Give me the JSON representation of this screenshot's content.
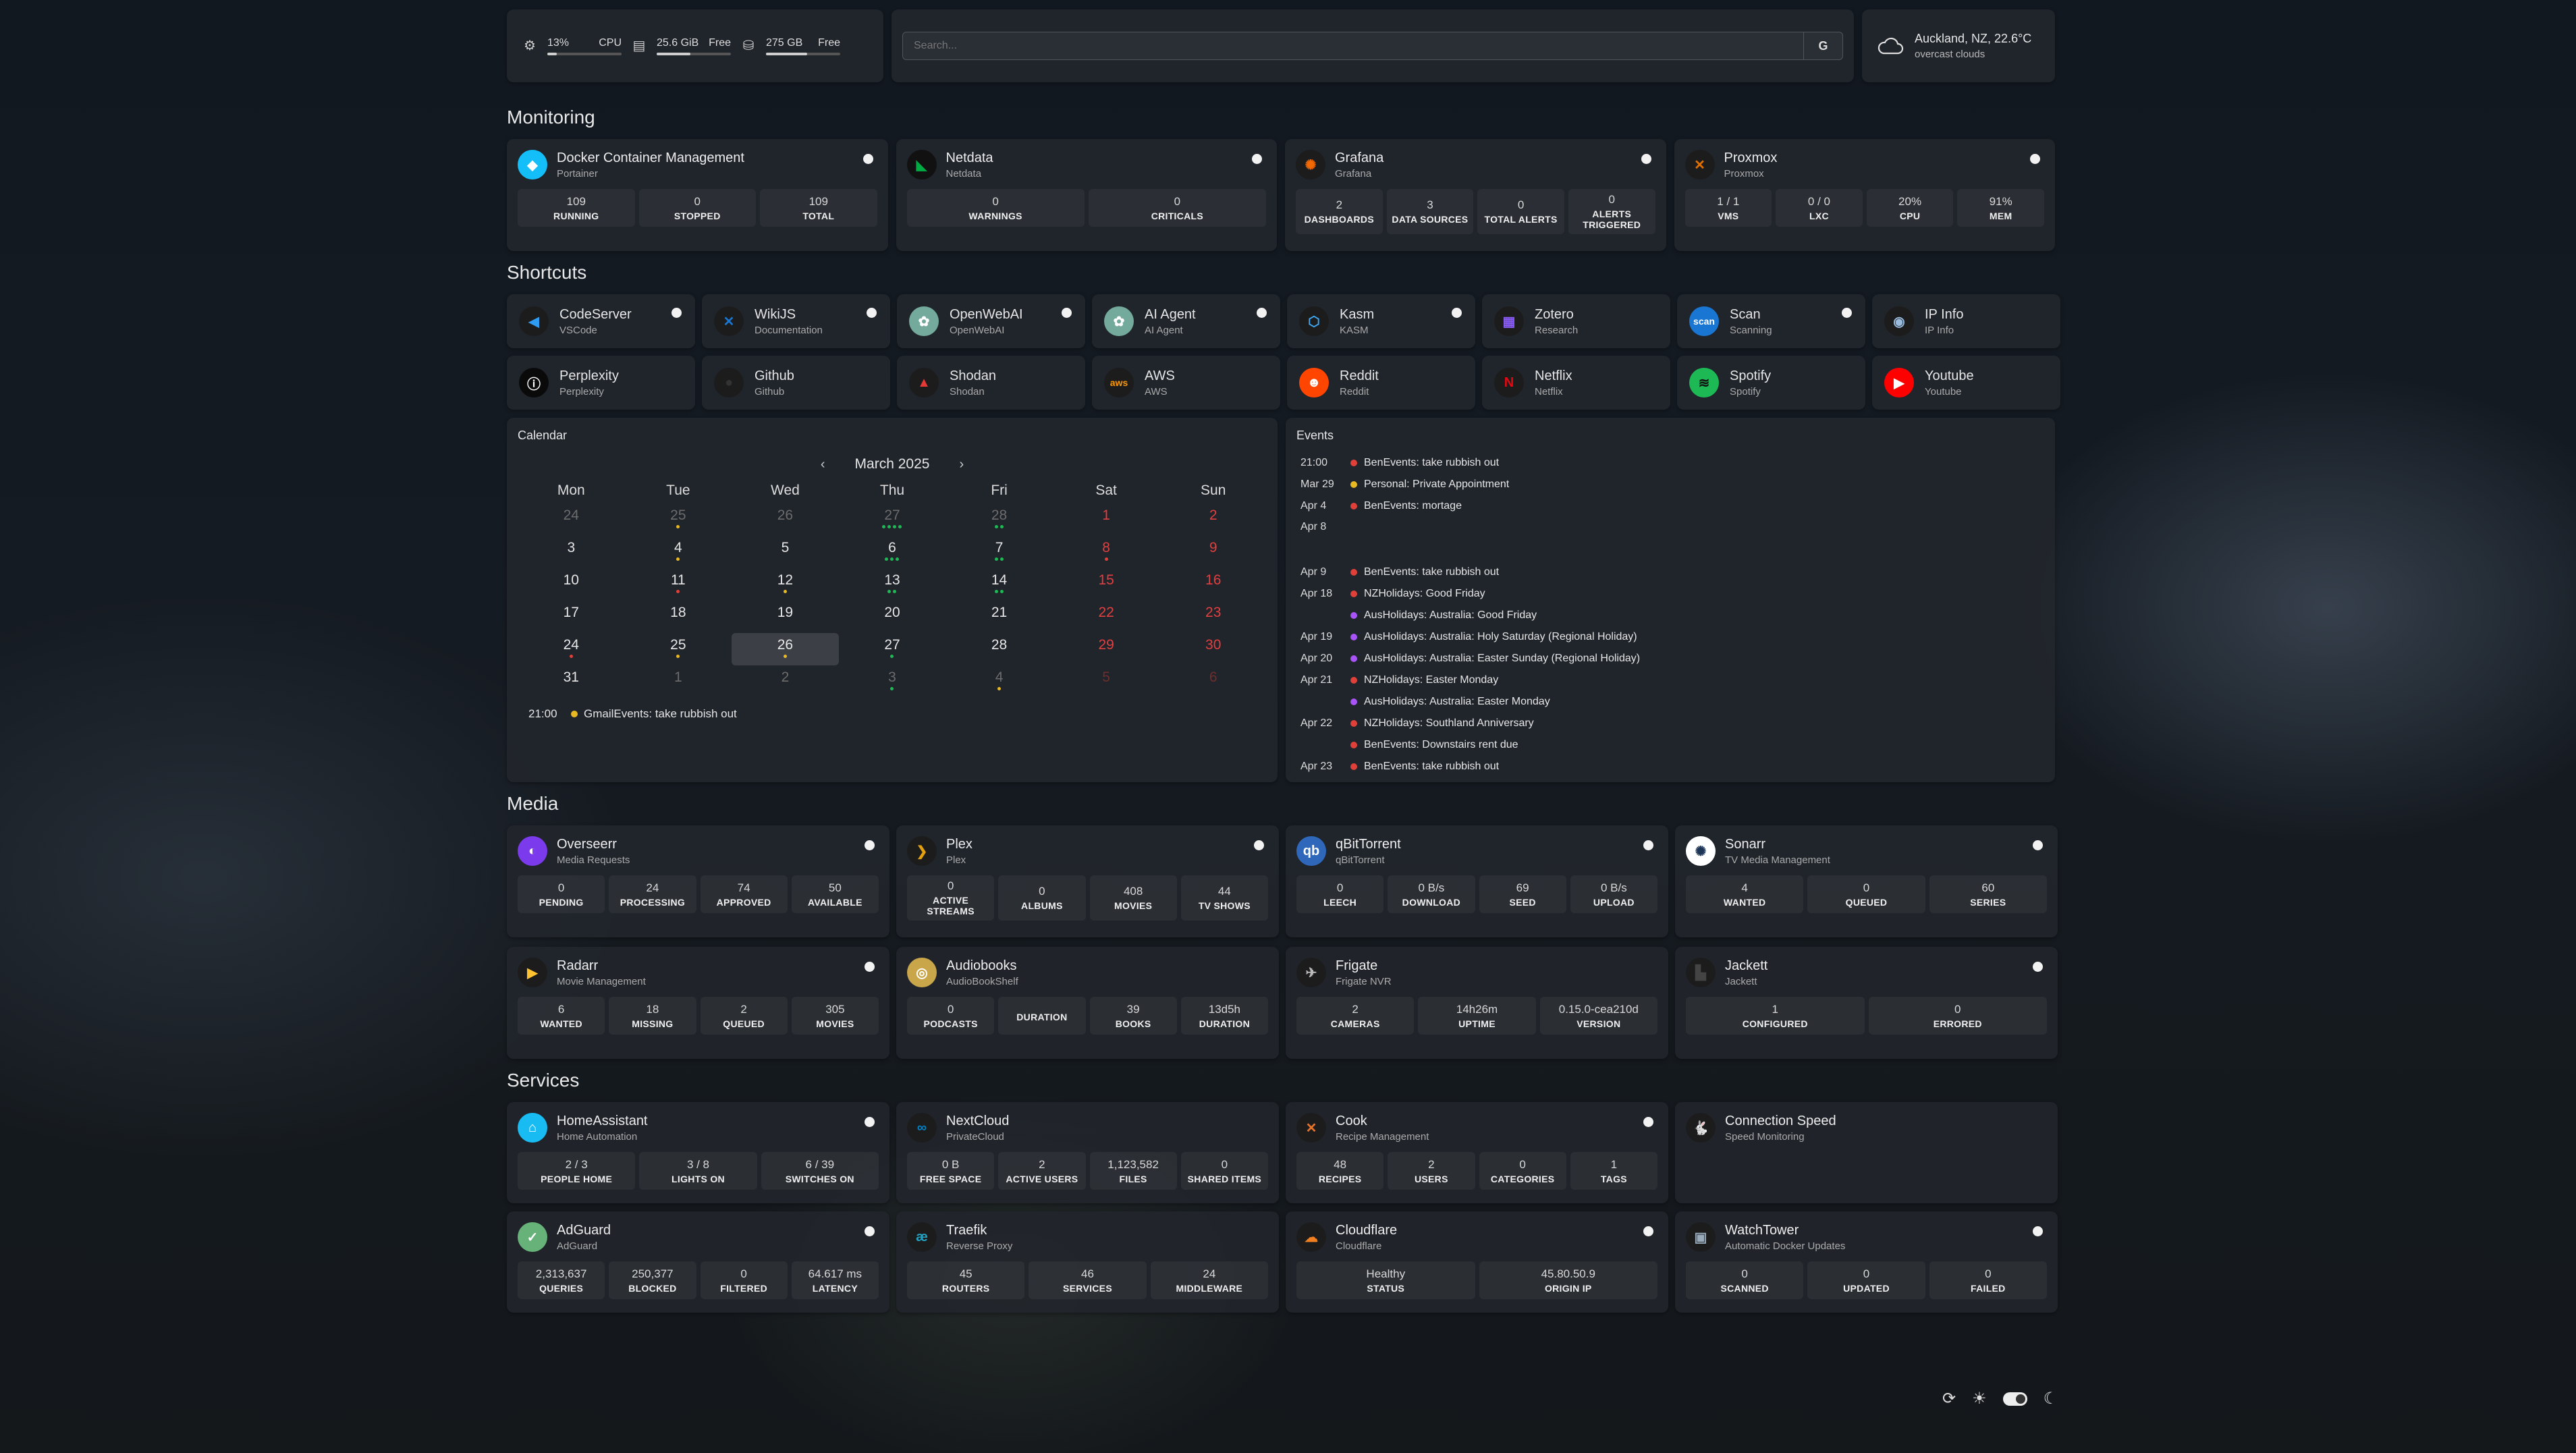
{
  "resources": {
    "cpu_value": "13%",
    "cpu_label": "CPU",
    "cpu_fraction": 0.13,
    "mem_value": "25.6 GiB",
    "mem_label": "Free",
    "mem_fraction": 0.45,
    "disk_value": "275 GB",
    "disk_label": "Free",
    "disk_fraction": 0.55
  },
  "search": {
    "placeholder": "Search...",
    "button": "G"
  },
  "weather": {
    "location": "Auckland, NZ, 22.6°C",
    "condition": "overcast clouds"
  },
  "sections": {
    "monitoring": "Monitoring",
    "shortcuts": "Shortcuts",
    "media": "Media",
    "services": "Services"
  },
  "monitoring": [
    {
      "name": "Docker Container Management",
      "sub": "Portainer",
      "stats": [
        [
          "109",
          "RUNNING"
        ],
        [
          "0",
          "STOPPED"
        ],
        [
          "109",
          "TOTAL"
        ]
      ]
    },
    {
      "name": "Netdata",
      "sub": "Netdata",
      "stats": [
        [
          "0",
          "WARNINGS"
        ],
        [
          "0",
          "CRITICALS"
        ]
      ]
    },
    {
      "name": "Grafana",
      "sub": "Grafana",
      "stats": [
        [
          "2",
          "DASHBOARDS"
        ],
        [
          "3",
          "DATA SOURCES"
        ],
        [
          "0",
          "TOTAL ALERTS"
        ],
        [
          "0",
          "ALERTS TRIGGERED"
        ]
      ]
    },
    {
      "name": "Proxmox",
      "sub": "Proxmox",
      "stats": [
        [
          "1 / 1",
          "VMS"
        ],
        [
          "0 / 0",
          "LXC"
        ],
        [
          "20%",
          "CPU"
        ],
        [
          "91%",
          "MEM"
        ]
      ]
    }
  ],
  "shortcuts": [
    {
      "name": "CodeServer",
      "sub": "VSCode"
    },
    {
      "name": "WikiJS",
      "sub": "Documentation"
    },
    {
      "name": "OpenWebAI",
      "sub": "OpenWebAI"
    },
    {
      "name": "AI Agent",
      "sub": "AI Agent"
    },
    {
      "name": "Kasm",
      "sub": "KASM"
    },
    {
      "name": "Zotero",
      "sub": "Research"
    },
    {
      "name": "Scan",
      "sub": "Scanning"
    },
    {
      "name": "IP Info",
      "sub": "IP Info"
    },
    {
      "name": "Perplexity",
      "sub": "Perplexity"
    },
    {
      "name": "Github",
      "sub": "Github"
    },
    {
      "name": "Shodan",
      "sub": "Shodan"
    },
    {
      "name": "AWS",
      "sub": "AWS"
    },
    {
      "name": "Reddit",
      "sub": "Reddit"
    },
    {
      "name": "Netflix",
      "sub": "Netflix"
    },
    {
      "name": "Spotify",
      "sub": "Spotify"
    },
    {
      "name": "Youtube",
      "sub": "Youtube"
    }
  ],
  "calendar": {
    "title": "Calendar",
    "month": "March 2025",
    "prev": "‹",
    "next": "›",
    "weekdays": [
      "Mon",
      "Tue",
      "Wed",
      "Thu",
      "Fri",
      "Sat",
      "Sun"
    ],
    "days": [
      [
        "24",
        "25",
        "26",
        "27",
        "28",
        "1",
        "2"
      ],
      [
        "3",
        "4",
        "5",
        "6",
        "7",
        "8",
        "9"
      ],
      [
        "10",
        "11",
        "12",
        "13",
        "14",
        "15",
        "16"
      ],
      [
        "17",
        "18",
        "19",
        "20",
        "21",
        "22",
        "23"
      ],
      [
        "24",
        "25",
        "26",
        "27",
        "28",
        "29",
        "30"
      ],
      [
        "31",
        "1",
        "2",
        "3",
        "4",
        "5",
        "6"
      ]
    ],
    "event_time": "21:00",
    "event_text": "GmailEvents: take rubbish out"
  },
  "events": {
    "title": "Events",
    "items": [
      {
        "date": "21:00",
        "color": "#e0403a",
        "text": "BenEvents: take rubbish out"
      },
      {
        "date": "Mar 29",
        "color": "#e8b923",
        "text": "Personal: Private Appointment"
      },
      {
        "date": "Apr 4",
        "color": "#e0403a",
        "text": "BenEvents: mortage"
      },
      {
        "date": "Apr 8",
        "color": "",
        "text": ""
      },
      {
        "date": "Apr 9",
        "color": "#e0403a",
        "text": "BenEvents: take rubbish out"
      },
      {
        "date": "Apr 18",
        "color": "#e0403a",
        "text": "NZHolidays: Good Friday"
      },
      {
        "date": "",
        "color": "#a855f7",
        "text": "AusHolidays: Australia: Good Friday"
      },
      {
        "date": "Apr 19",
        "color": "#a855f7",
        "text": "AusHolidays: Australia: Holy Saturday (Regional Holiday)"
      },
      {
        "date": "Apr 20",
        "color": "#a855f7",
        "text": "AusHolidays: Australia: Easter Sunday (Regional Holiday)"
      },
      {
        "date": "Apr 21",
        "color": "#e0403a",
        "text": "NZHolidays: Easter Monday"
      },
      {
        "date": "",
        "color": "#a855f7",
        "text": "AusHolidays: Australia: Easter Monday"
      },
      {
        "date": "Apr 22",
        "color": "#e0403a",
        "text": "NZHolidays: Southland Anniversary"
      },
      {
        "date": "",
        "color": "#e0403a",
        "text": "BenEvents: Downstairs rent due"
      },
      {
        "date": "Apr 23",
        "color": "#e0403a",
        "text": "BenEvents: take rubbish out"
      }
    ]
  },
  "media": [
    {
      "name": "Overseerr",
      "sub": "Media Requests",
      "stats": [
        [
          "0",
          "PENDING"
        ],
        [
          "24",
          "PROCESSING"
        ],
        [
          "74",
          "APPROVED"
        ],
        [
          "50",
          "AVAILABLE"
        ]
      ]
    },
    {
      "name": "Plex",
      "sub": "Plex",
      "stats": [
        [
          "0",
          "ACTIVE STREAMS"
        ],
        [
          "0",
          "ALBUMS"
        ],
        [
          "408",
          "MOVIES"
        ],
        [
          "44",
          "TV SHOWS"
        ]
      ]
    },
    {
      "name": "qBitTorrent",
      "sub": "qBitTorrent",
      "stats": [
        [
          "0",
          "LEECH"
        ],
        [
          "0 B/s",
          "DOWNLOAD"
        ],
        [
          "69",
          "SEED"
        ],
        [
          "0 B/s",
          "UPLOAD"
        ]
      ]
    },
    {
      "name": "Sonarr",
      "sub": "TV Media Management",
      "stats": [
        [
          "4",
          "WANTED"
        ],
        [
          "0",
          "QUEUED"
        ],
        [
          "60",
          "SERIES"
        ]
      ]
    },
    {
      "name": "Radarr",
      "sub": "Movie Management",
      "stats": [
        [
          "6",
          "WANTED"
        ],
        [
          "18",
          "MISSING"
        ],
        [
          "2",
          "QUEUED"
        ],
        [
          "305",
          "MOVIES"
        ]
      ]
    },
    {
      "name": "Audiobooks",
      "sub": "AudioBookShelf",
      "stats": [
        [
          "0",
          "PODCASTS"
        ],
        [
          "",
          "DURATION"
        ],
        [
          "39",
          "BOOKS"
        ],
        [
          "13d5h",
          "DURATION"
        ]
      ]
    },
    {
      "name": "Frigate",
      "sub": "Frigate NVR",
      "stats": [
        [
          "2",
          "CAMERAS"
        ],
        [
          "14h26m",
          "UPTIME"
        ],
        [
          "0.15.0-cea210d",
          "VERSION"
        ]
      ]
    },
    {
      "name": "Jackett",
      "sub": "Jackett",
      "stats": [
        [
          "1",
          "CONFIGURED"
        ],
        [
          "0",
          "ERRORED"
        ]
      ]
    }
  ],
  "services": [
    {
      "name": "HomeAssistant",
      "sub": "Home Automation",
      "stats": [
        [
          "2 / 3",
          "PEOPLE HOME"
        ],
        [
          "3 / 8",
          "LIGHTS ON"
        ],
        [
          "6 / 39",
          "SWITCHES ON"
        ]
      ]
    },
    {
      "name": "NextCloud",
      "sub": "PrivateCloud",
      "stats": [
        [
          "0 B",
          "FREE SPACE"
        ],
        [
          "2",
          "ACTIVE USERS"
        ],
        [
          "1,123,582",
          "FILES"
        ],
        [
          "0",
          "SHARED ITEMS"
        ]
      ]
    },
    {
      "name": "Cook",
      "sub": "Recipe Management",
      "stats": [
        [
          "48",
          "RECIPES"
        ],
        [
          "2",
          "USERS"
        ],
        [
          "0",
          "CATEGORIES"
        ],
        [
          "1",
          "TAGS"
        ]
      ]
    },
    {
      "name": "Connection Speed",
      "sub": "Speed Monitoring",
      "stats": []
    },
    {
      "name": "AdGuard",
      "sub": "AdGuard",
      "stats": [
        [
          "2,313,637",
          "QUERIES"
        ],
        [
          "250,377",
          "BLOCKED"
        ],
        [
          "0",
          "FILTERED"
        ],
        [
          "64.617 ms",
          "LATENCY"
        ]
      ]
    },
    {
      "name": "Traefik",
      "sub": "Reverse Proxy",
      "stats": [
        [
          "45",
          "ROUTERS"
        ],
        [
          "46",
          "SERVICES"
        ],
        [
          "24",
          "MIDDLEWARE"
        ]
      ]
    },
    {
      "name": "Cloudflare",
      "sub": "Cloudflare",
      "stats": [
        [
          "Healthy",
          "STATUS"
        ],
        [
          "45.80.50.9",
          "ORIGIN IP"
        ]
      ]
    },
    {
      "name": "WatchTower",
      "sub": "Automatic Docker Updates",
      "stats": [
        [
          "0",
          "SCANNED"
        ],
        [
          "0",
          "UPDATED"
        ],
        [
          "0",
          "FAILED"
        ]
      ]
    }
  ]
}
